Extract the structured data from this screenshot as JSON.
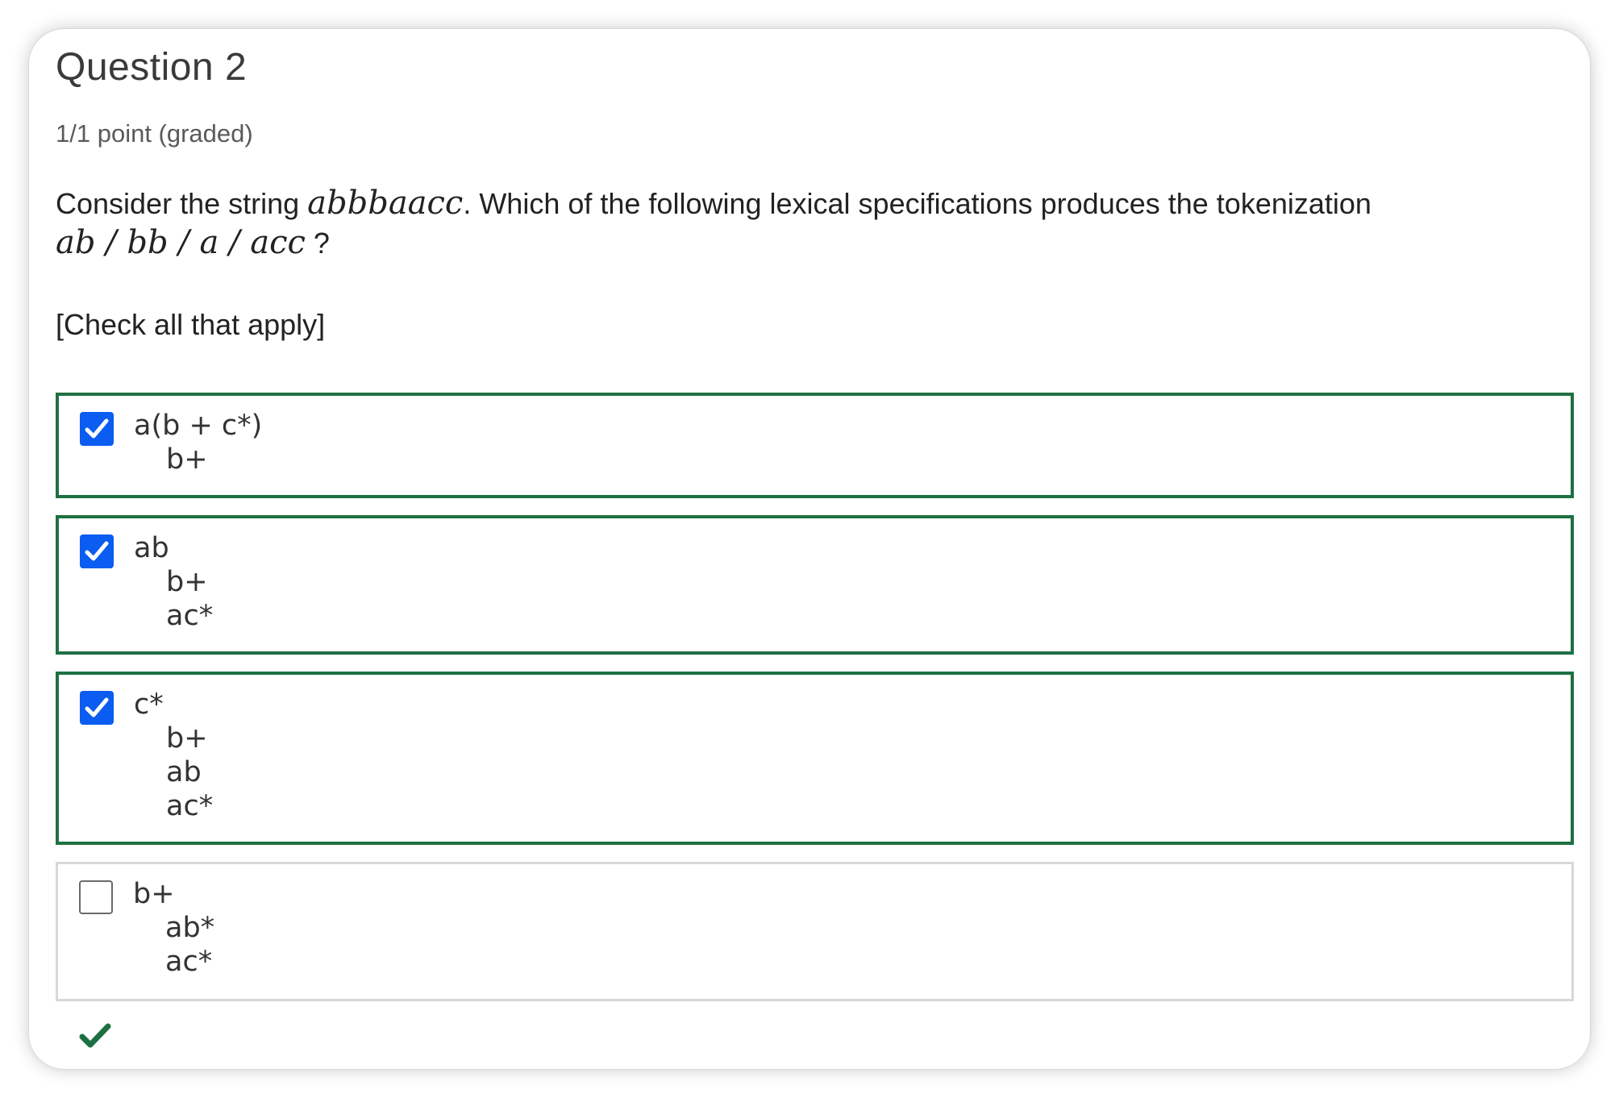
{
  "question": {
    "title": "Question 2",
    "points": "1/1 point (graded)",
    "prompt_before": "Consider the string ",
    "prompt_string": "abbbaacc",
    "prompt_after": ". Which of the following lexical specifications produces the tokenization",
    "tokenization": "ab / bb / a / acc",
    "question_mark": " ?",
    "instruction": "[Check all that apply]"
  },
  "choices": [
    {
      "checked": true,
      "status": "correct",
      "lines": [
        "a(b + c*)",
        "b+"
      ]
    },
    {
      "checked": true,
      "status": "correct",
      "lines": [
        "ab",
        "b+",
        "ac*"
      ]
    },
    {
      "checked": true,
      "status": "correct",
      "lines": [
        "c*",
        "b+",
        "ab",
        "ac*"
      ]
    },
    {
      "checked": false,
      "status": "none",
      "lines": [
        "b+",
        "ab*",
        "ac*"
      ]
    }
  ],
  "result": {
    "icon": "checkmark-icon",
    "status": "correct"
  },
  "colors": {
    "correct_border": "#1e7042",
    "checkbox_checked": "#0b5cf0",
    "result_check": "#1e7042"
  }
}
